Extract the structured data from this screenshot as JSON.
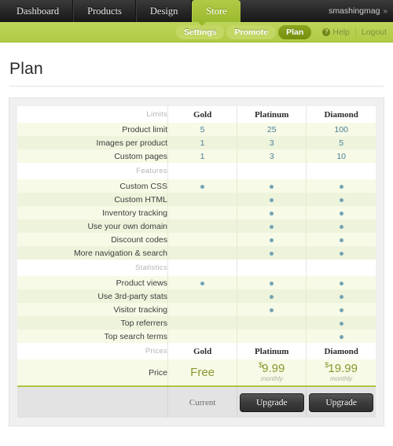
{
  "topnav": {
    "tabs": [
      {
        "label": "Dashboard",
        "active": false
      },
      {
        "label": "Products",
        "active": false
      },
      {
        "label": "Design",
        "active": false
      },
      {
        "label": "Store",
        "active": true
      }
    ],
    "account_name": "smashingmag",
    "account_caret": "»"
  },
  "subnav": {
    "pills": [
      {
        "label": "Settings",
        "active": false
      },
      {
        "label": "Promote",
        "active": false
      },
      {
        "label": "Plan",
        "active": true
      }
    ],
    "help_label": "Help",
    "help_icon_glyph": "?",
    "logout_label": "Logout"
  },
  "page": {
    "title": "Plan"
  },
  "plans": [
    "Gold",
    "Platinum",
    "Diamond"
  ],
  "sections": [
    {
      "name": "Limits",
      "plan_headers": [
        "Gold",
        "Platinum",
        "Diamond"
      ],
      "rows": [
        {
          "label": "Product limit",
          "values": [
            "5",
            "25",
            "100"
          ]
        },
        {
          "label": "Images per product",
          "values": [
            "1",
            "3",
            "5"
          ]
        },
        {
          "label": "Custom pages",
          "values": [
            "1",
            "3",
            "10"
          ]
        }
      ]
    },
    {
      "name": "Features",
      "plan_headers": [
        "",
        "",
        ""
      ],
      "rows": [
        {
          "label": "Custom CSS",
          "marks": [
            true,
            true,
            true
          ]
        },
        {
          "label": "Custom HTML",
          "marks": [
            false,
            true,
            true
          ]
        },
        {
          "label": "Inventory tracking",
          "marks": [
            false,
            true,
            true
          ]
        },
        {
          "label": "Use your own domain",
          "marks": [
            false,
            true,
            true
          ]
        },
        {
          "label": "Discount codes",
          "marks": [
            false,
            true,
            true
          ]
        },
        {
          "label": "More navigation & search",
          "marks": [
            false,
            true,
            true
          ]
        }
      ]
    },
    {
      "name": "Statistics",
      "plan_headers": [
        "",
        "",
        ""
      ],
      "rows": [
        {
          "label": "Product views",
          "marks": [
            true,
            true,
            true
          ]
        },
        {
          "label": "Use 3rd-party stats",
          "marks": [
            false,
            true,
            true
          ]
        },
        {
          "label": "Visitor tracking",
          "marks": [
            false,
            true,
            true
          ]
        },
        {
          "label": "Top referrers",
          "marks": [
            false,
            false,
            true
          ]
        },
        {
          "label": "Top search terms",
          "marks": [
            false,
            false,
            true
          ]
        }
      ]
    }
  ],
  "prices": {
    "section_name": "Prices",
    "plan_headers": [
      "Gold",
      "Platinum",
      "Diamond"
    ],
    "row_label": "Price",
    "cells": [
      {
        "free_text": "Free"
      },
      {
        "currency": "$",
        "amount": "9.99",
        "period": "monthly"
      },
      {
        "currency": "$",
        "amount": "19.99",
        "period": "monthly"
      }
    ]
  },
  "actions": [
    {
      "type": "text",
      "label": "Current"
    },
    {
      "type": "button",
      "label": "Upgrade"
    },
    {
      "type": "button",
      "label": "Upgrade"
    }
  ],
  "colors": {
    "brand_green": "#b0cb44",
    "active_pill": "#7f9c15",
    "value_blue": "#4a7f96",
    "dot": "#74a3b4",
    "price_olive": "#8d972f",
    "row_a": "#f7fae6",
    "row_b": "#eef4dc",
    "footer_gray": "#e3e3e3"
  }
}
